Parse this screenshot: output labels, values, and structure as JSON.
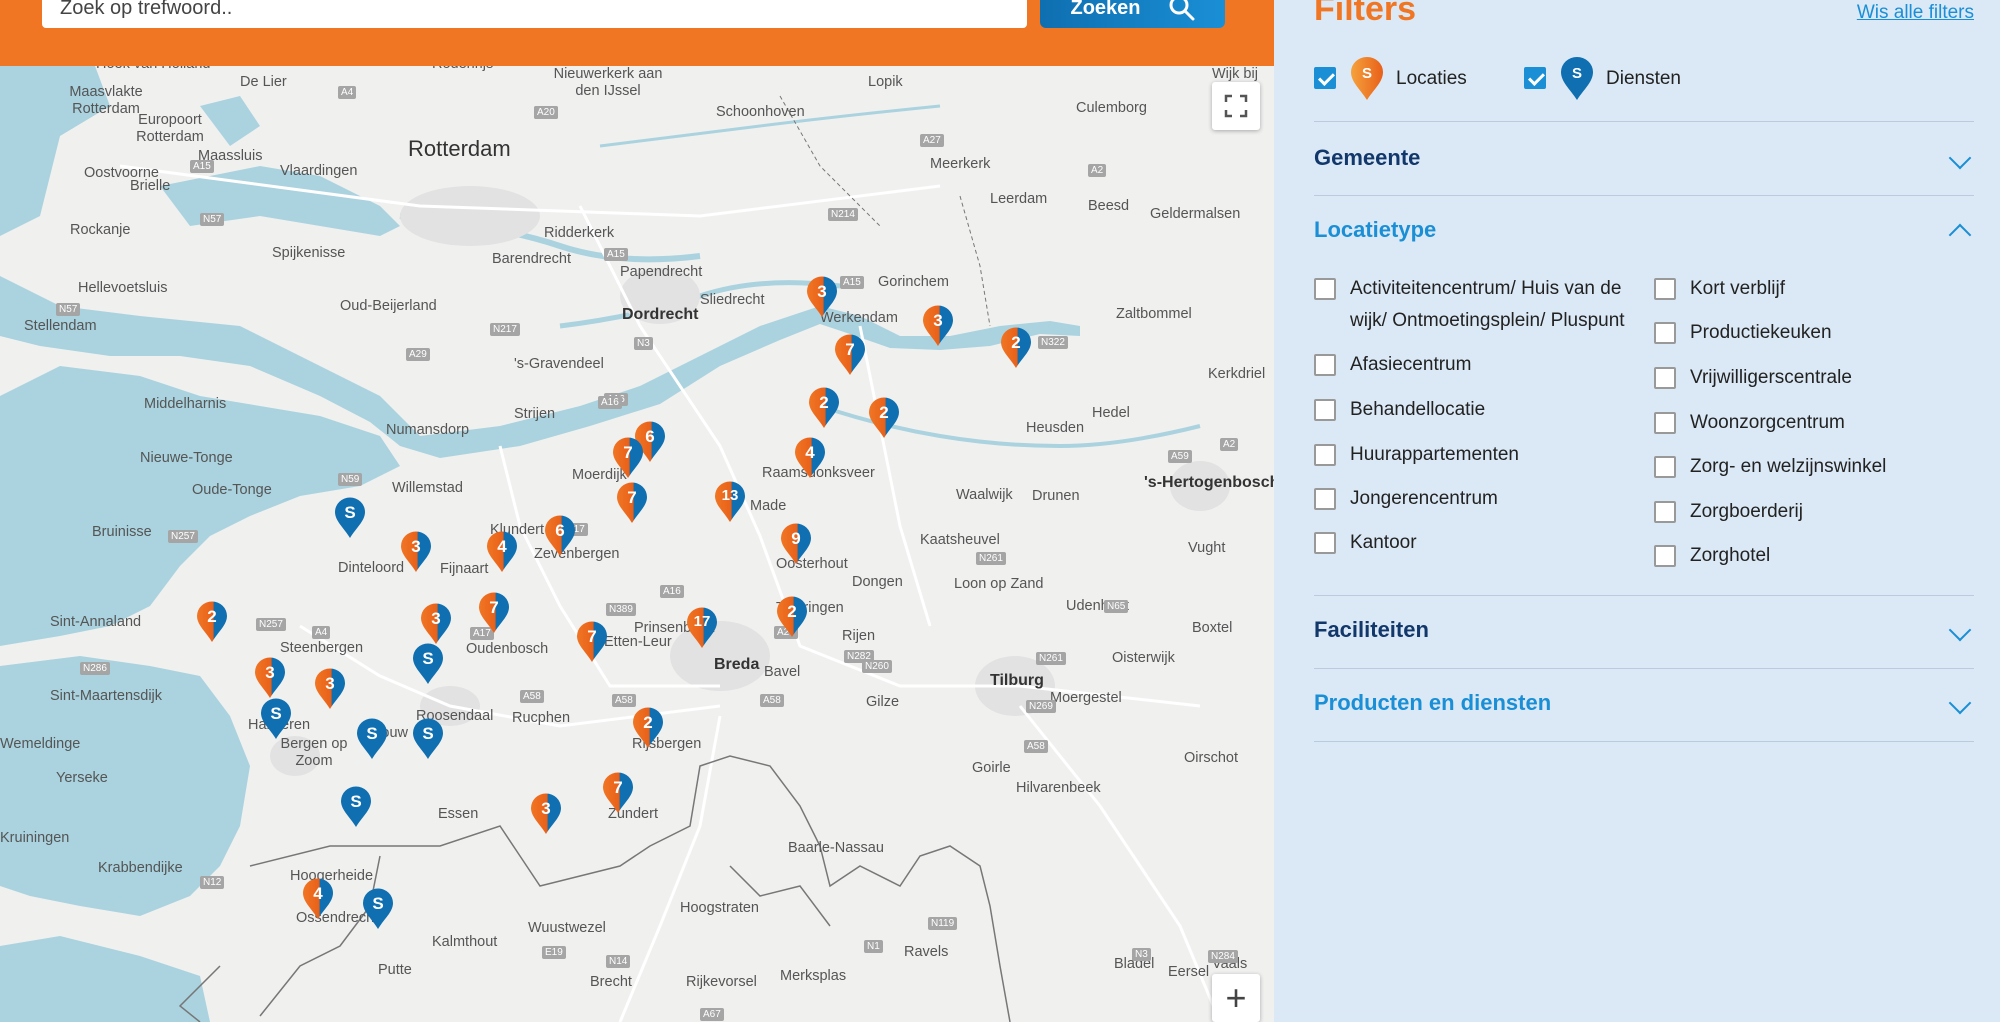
{
  "search": {
    "placeholder": "Zoek op trefwoord..",
    "button_label": "Zoeken"
  },
  "filters": {
    "title": "Filters",
    "show_all": "Wis alle filters",
    "types": [
      {
        "label": "Locaties",
        "checked": true,
        "pin_letter": "S"
      },
      {
        "label": "Diensten",
        "checked": true,
        "pin_letter": "S"
      }
    ],
    "sections": [
      {
        "label": "Gemeente",
        "expanded": false
      },
      {
        "label": "Locatietype",
        "expanded": true
      },
      {
        "label": "Faciliteiten",
        "expanded": false
      },
      {
        "label": "Producten en diensten",
        "expanded": false
      }
    ],
    "locatietype_left": [
      {
        "label": "Activiteitencentrum/ Huis van de",
        "label2": "wijk/ Ontmoetingsplein/ Pluspunt"
      },
      {
        "label": "Afasiecentrum"
      },
      {
        "label": "Behandellocatie"
      },
      {
        "label": "Huurappartementen"
      },
      {
        "label": "Jongerencentrum"
      },
      {
        "label": "Kantoor"
      }
    ],
    "locatietype_right": [
      {
        "label": "Kort verblijf"
      },
      {
        "label": "Productiekeuken"
      },
      {
        "label": "Vrijwilligerscentrale"
      },
      {
        "label": "Woonzorgcentrum"
      },
      {
        "label": "Zorg- en welzijnswinkel"
      },
      {
        "label": "Zorgboerderij"
      },
      {
        "label": "Zorghotel"
      }
    ]
  },
  "colors": {
    "orange": "#f07623",
    "blue": "#0f6fb0",
    "accent": "#1a8fd6",
    "panel_bg": "#dbe9f6"
  },
  "map": {
    "places": [
      "Hoek van Holland",
      "De Lier",
      "Rodenrijs",
      "Nieuwerkerk aan den IJssel",
      "Lopik",
      "Wijk bij",
      "Maasvlakte Rotterdam",
      "Europoort Rotterdam",
      "Maassluis",
      "Rotterdam",
      "Schoonhoven",
      "Culemborg",
      "Oostvoorne",
      "Vlaardingen",
      "Meerkerk",
      "Brielle",
      "Leerdam",
      "Beesd",
      "Geldermalsen",
      "Rockanje",
      "Ridderkerk",
      "Spijkenisse",
      "Barendrecht",
      "Papendrecht",
      "Hellevoetsluis",
      "Gorinchem",
      "Oud-Beijerland",
      "Dordrecht",
      "Sliedrecht",
      "Zaltbommel",
      "Stellendam",
      "Werkendam",
      "'s-Gravendeel",
      "Kerkdriel",
      "Middelharnis",
      "Strijen",
      "Hedel",
      "Numansdorp",
      "Heusden",
      "Nieuwe-Tonge",
      "Moerdijk",
      "Raamsdonksveer",
      "Waalwijk",
      "Drunen",
      "'s-Hertogenbosch",
      "Oude-Tonge",
      "Willemstad",
      "Made",
      "Bruinisse",
      "Klundert",
      "Zevenbergen",
      "Kaatsheuvel",
      "Vught",
      "Dinteloord",
      "Fijnaart",
      "Oosterhout",
      "Dongen",
      "Loon op Zand",
      "Udenhout",
      "Teteringen",
      "Sint-Annaland",
      "Steenbergen",
      "Oudenbosch",
      "Prinsenbeek",
      "Etten-Leur",
      "Rijen",
      "Breda",
      "Bavel",
      "Oisterwijk",
      "Boxtel",
      "Tilburg",
      "Sint-Maartensdijk",
      "Roosendaal",
      "Rucphen",
      "Gilze",
      "Moergestel",
      "Halsteren",
      "Wouw",
      "Wemeldinge",
      "Bergen op Zoom",
      "Rijsbergen",
      "Goirle",
      "Oirschot",
      "Yerseke",
      "Hilvarenbeek",
      "Essen",
      "Zundert",
      "Kruiningen",
      "Baarle-Nassau",
      "Krabbendijke",
      "Hoogerheide",
      "Hoogstraten",
      "Ossendrecht",
      "Wuustwezel",
      "Kalmthout",
      "Ravels",
      "Bladel",
      "Putte",
      "Brecht",
      "Rijkevorsel",
      "Merksplas",
      "Eersel",
      "Vaals"
    ],
    "roads": [
      "A4",
      "A20",
      "A20",
      "A27",
      "A2",
      "N57",
      "A15",
      "N214",
      "A15",
      "A15",
      "N57",
      "N217",
      "A16",
      "N3",
      "N322",
      "A29",
      "A16",
      "A59",
      "A2",
      "N59",
      "A17",
      "N257",
      "A16",
      "N261",
      "N389",
      "N65",
      "N257",
      "A4",
      "A17",
      "A27",
      "N282",
      "N286",
      "A58",
      "N260",
      "N261",
      "A58",
      "A58",
      "N269",
      "A58",
      "N12",
      "N119",
      "N1",
      "E19",
      "N14",
      "A67",
      "N284",
      "N3"
    ],
    "markers": [
      {
        "label": "3",
        "kind": "loc"
      },
      {
        "label": "3",
        "kind": "loc"
      },
      {
        "label": "7",
        "kind": "loc"
      },
      {
        "label": "2",
        "kind": "loc"
      },
      {
        "label": "2",
        "kind": "loc"
      },
      {
        "label": "2",
        "kind": "loc"
      },
      {
        "label": "6",
        "kind": "loc"
      },
      {
        "label": "7",
        "kind": "loc"
      },
      {
        "label": "4",
        "kind": "loc"
      },
      {
        "label": "7",
        "kind": "loc"
      },
      {
        "label": "13",
        "kind": "loc"
      },
      {
        "label": "S",
        "kind": "svc"
      },
      {
        "label": "3",
        "kind": "loc"
      },
      {
        "label": "4",
        "kind": "loc"
      },
      {
        "label": "6",
        "kind": "loc"
      },
      {
        "label": "9",
        "kind": "loc"
      },
      {
        "label": "2",
        "kind": "loc"
      },
      {
        "label": "3",
        "kind": "loc"
      },
      {
        "label": "7",
        "kind": "loc"
      },
      {
        "label": "7",
        "kind": "loc"
      },
      {
        "label": "17",
        "kind": "loc"
      },
      {
        "label": "2",
        "kind": "loc"
      },
      {
        "label": "S",
        "kind": "svc"
      },
      {
        "label": "3",
        "kind": "loc"
      },
      {
        "label": "3",
        "kind": "loc"
      },
      {
        "label": "S",
        "kind": "svc"
      },
      {
        "label": "S",
        "kind": "svc"
      },
      {
        "label": "S",
        "kind": "svc"
      },
      {
        "label": "2",
        "kind": "loc"
      },
      {
        "label": "S",
        "kind": "svc"
      },
      {
        "label": "7",
        "kind": "loc"
      },
      {
        "label": "3",
        "kind": "loc"
      },
      {
        "label": "4",
        "kind": "loc"
      },
      {
        "label": "S",
        "kind": "svc"
      }
    ],
    "zoom_in_label": "+"
  }
}
